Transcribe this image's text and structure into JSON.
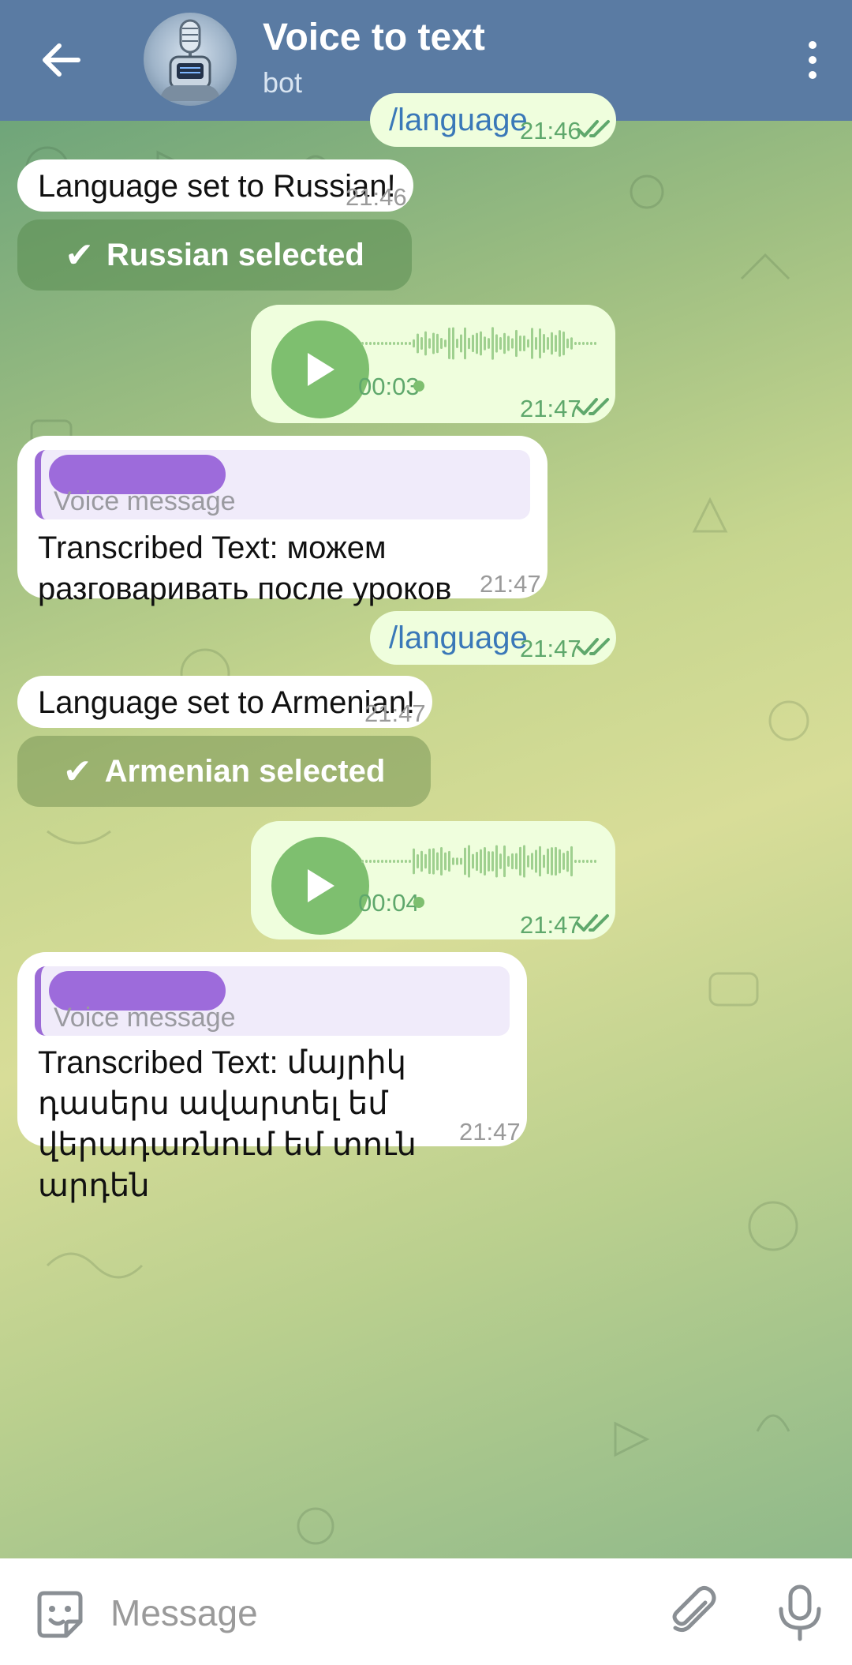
{
  "header": {
    "title": "Voice to text",
    "subtitle": "bot"
  },
  "messages": {
    "m1": {
      "text": "/language",
      "time": "21:46"
    },
    "m2": {
      "text": "Language set to Russian!",
      "time": "21:46"
    },
    "m3": {
      "button": "Russian selected"
    },
    "m4": {
      "duration": "00:03",
      "time": "21:47"
    },
    "m5": {
      "reply_label": "Voice message",
      "text": "Transcribed Text: можем разговаривать после уроков",
      "time": "21:47"
    },
    "m6": {
      "text": "/language",
      "time": "21:47"
    },
    "m7": {
      "text": "Language set to Armenian!",
      "time": "21:47"
    },
    "m8": {
      "button": "Armenian selected"
    },
    "m9": {
      "duration": "00:04",
      "time": "21:47"
    },
    "m10": {
      "reply_label": "Voice message",
      "text": "Transcribed Text: մայրիկ դասերս ավարտել եմ վերադառնում եմ տուն արդեն",
      "time": "21:47"
    }
  },
  "input": {
    "placeholder": "Message"
  },
  "colors": {
    "header": "#5a7ba3",
    "outgoing_bubble": "#effedd",
    "incoming_bubble": "#ffffff",
    "accent_green": "#7ebf6f",
    "redaction": "#9d6bdb"
  }
}
